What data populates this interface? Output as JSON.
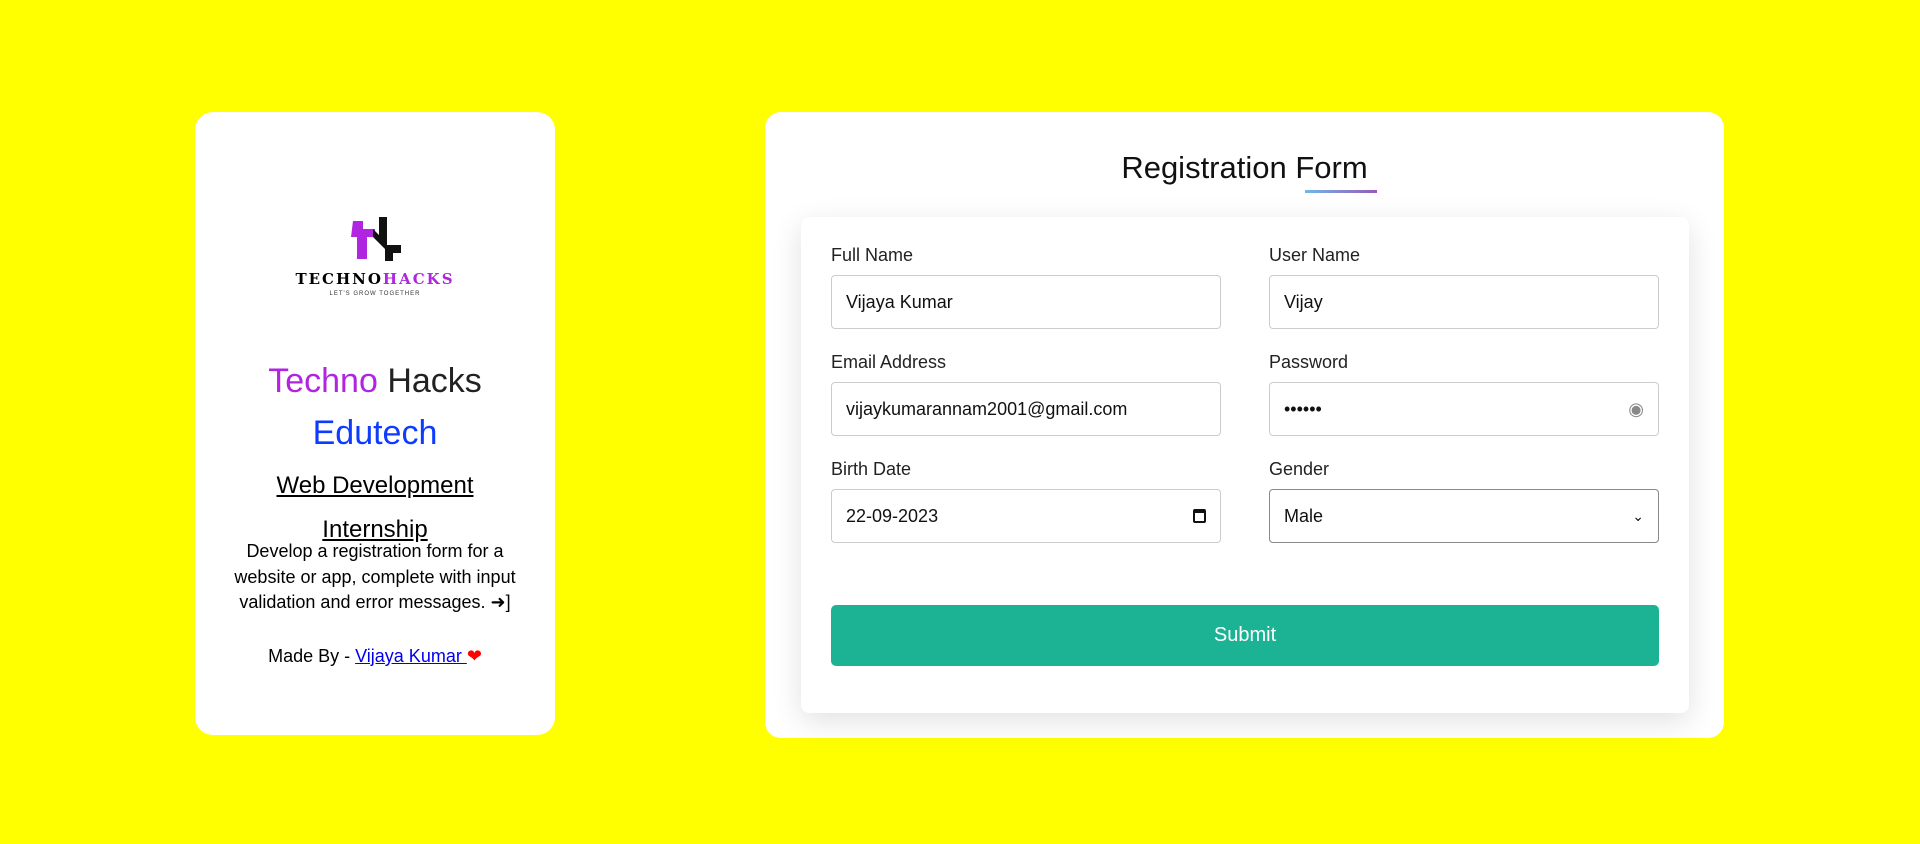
{
  "side": {
    "logo": {
      "word_dark": "TECHNO",
      "word_accent": "HACKS",
      "tagline": "LET'S GROW TOGETHER"
    },
    "title_part1": "Techno",
    "title_part2": "Hacks",
    "subtitle": "Edutech",
    "heading": "Web Development Internship",
    "description": "Develop a registration form for a website or app, complete with input validation and error messages.",
    "made_by_prefix": "Made By - ",
    "author": "Vijaya Kumar ",
    "colors": {
      "techno": "#b026e0",
      "edutech": "#0d3bff"
    }
  },
  "form": {
    "title": "Registration Form",
    "fields": [
      {
        "label": "Full Name",
        "value": "Vijaya Kumar"
      },
      {
        "label": "User Name",
        "value": "Vijay"
      },
      {
        "label": "Email Address",
        "value": "vijaykumarannam2001@gmail.com"
      },
      {
        "label": "Password",
        "value": "••••••",
        "icon": "eye-icon"
      },
      {
        "label": "Birth Date",
        "value": "22-09-2023",
        "icon": "calendar-icon"
      },
      {
        "label": "Gender",
        "value": "Male",
        "icon": "chevron-down-icon"
      }
    ],
    "submit_label": "Submit",
    "accent": "#1cb394"
  }
}
